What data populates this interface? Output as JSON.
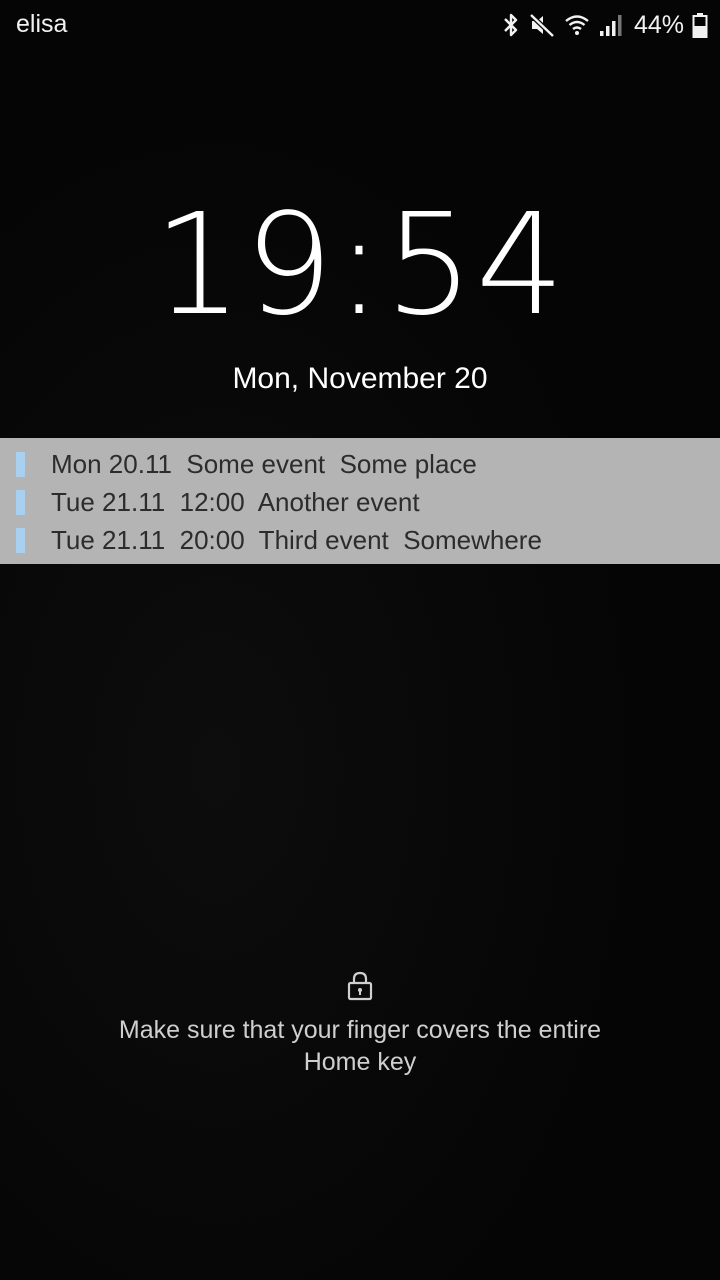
{
  "status_bar": {
    "carrier": "elisa",
    "battery_percent": "44%",
    "icons": [
      "bluetooth-icon",
      "mute-icon",
      "wifi-icon",
      "signal-icon",
      "battery-icon"
    ]
  },
  "lock_screen": {
    "time": "19:54",
    "date": "Mon, November 20",
    "events": [
      {
        "text": "Mon 20.11  Some event  Some place"
      },
      {
        "text": "Tue 21.11  12:00  Another event"
      },
      {
        "text": "Tue 21.11  20:00  Third event  Somewhere"
      }
    ],
    "lock_icon": "lock-icon",
    "hint": "Make sure that your finger covers the entire Home key"
  },
  "colors": {
    "background": "#050505",
    "event_band": "#b4b4b4",
    "event_marker": "#a9d0ee"
  }
}
